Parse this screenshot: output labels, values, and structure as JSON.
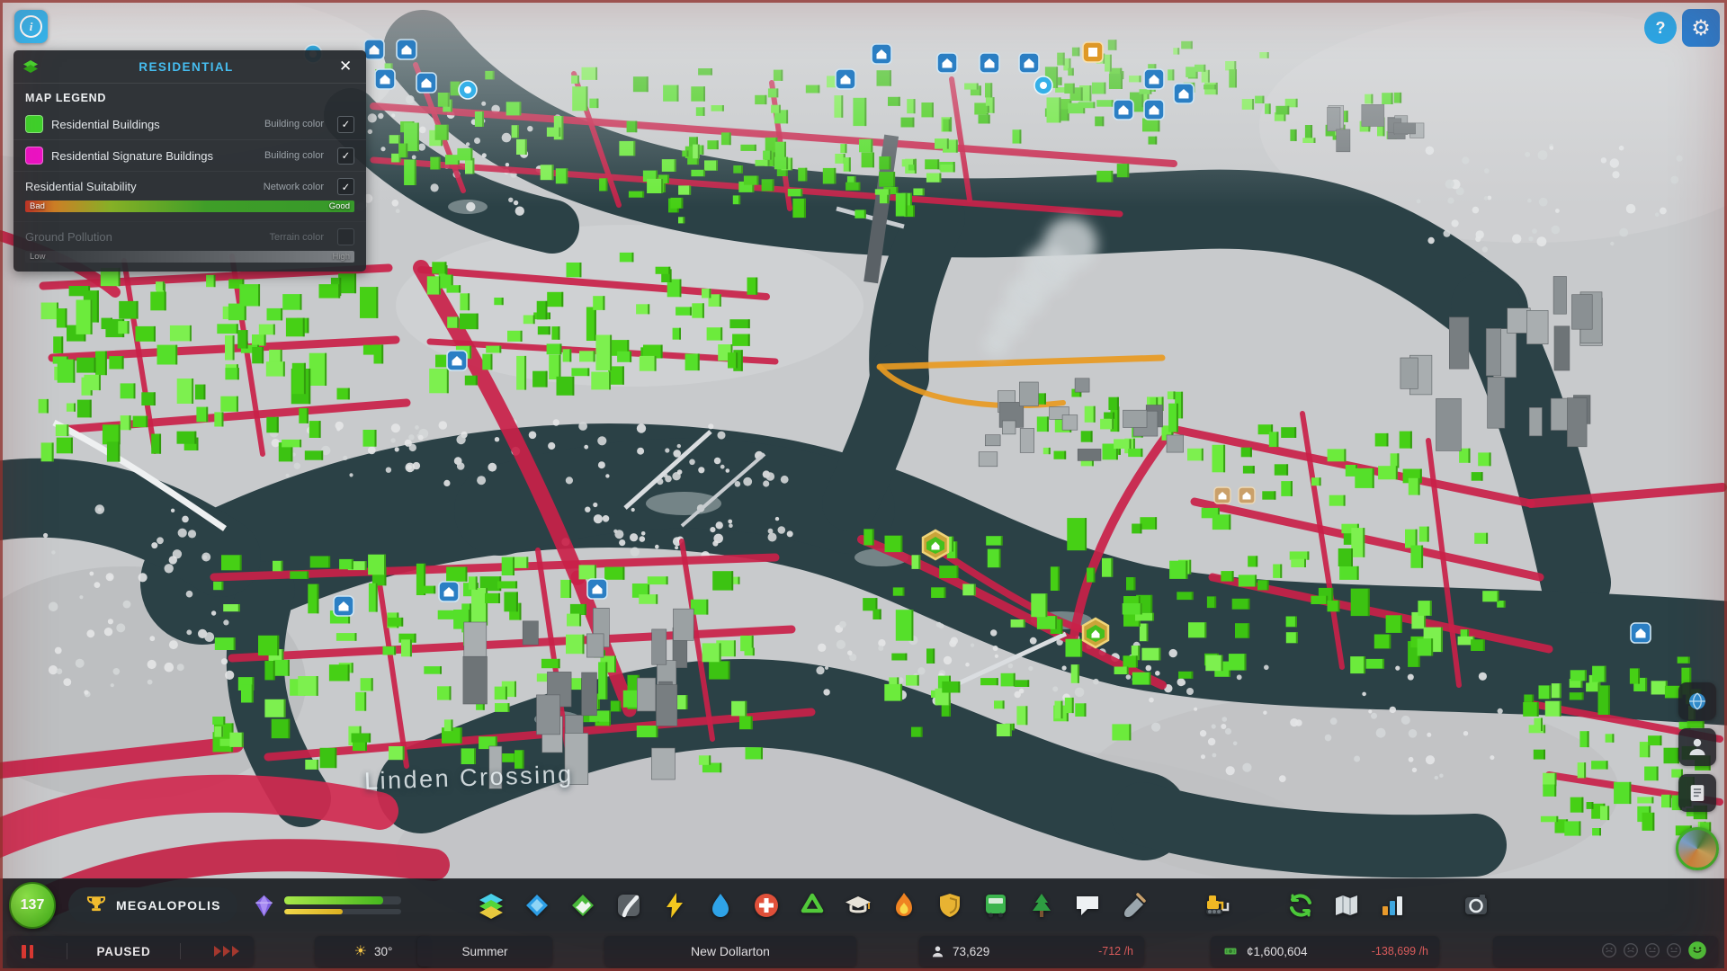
{
  "icons": {
    "check": "✓",
    "close": "✕",
    "help": "?",
    "info": "i",
    "gear": "⚙",
    "sun": "☀"
  },
  "colors": {
    "accent_cyan": "#46bdf0",
    "residential_green": "#3ed32b",
    "signature_magenta": "#ee13c6",
    "road_suitability_red": "#c92149",
    "negative_red": "#e06060",
    "money_green": "#4cb848"
  },
  "legend": {
    "title": "RESIDENTIAL",
    "section": "MAP LEGEND",
    "rows": [
      {
        "label": "Residential Buildings",
        "type": "Building color",
        "checked": true,
        "swatch": "#3ed32b"
      },
      {
        "label": "Residential Signature Buildings",
        "type": "Building color",
        "checked": true,
        "swatch": "#ee13c6"
      },
      {
        "label": "Residential Suitability",
        "type": "Network color",
        "checked": true,
        "scale_min": "Bad",
        "scale_max": "Good"
      },
      {
        "label": "Ground Pollution",
        "type": "Terrain color",
        "checked": false,
        "scale_min": "Low",
        "scale_max": "High",
        "disabled": true
      }
    ]
  },
  "map": {
    "place_label": "Linden Crossing"
  },
  "toolbar": {
    "xp": "137",
    "milestone": "MEGALOPOLIS",
    "progress": {
      "primary_pct": 85,
      "secondary_pct": 50
    },
    "tools": [
      {
        "name": "zoning",
        "icon": "zones"
      },
      {
        "name": "signature-areas",
        "icon": "diamond"
      },
      {
        "name": "terrain",
        "icon": "terrain"
      },
      {
        "name": "roads",
        "icon": "roads"
      },
      {
        "name": "electricity",
        "icon": "bolt"
      },
      {
        "name": "water-sewage",
        "icon": "drop"
      },
      {
        "name": "healthcare",
        "icon": "health"
      },
      {
        "name": "garbage",
        "icon": "recycle"
      },
      {
        "name": "education",
        "icon": "education"
      },
      {
        "name": "fire-rescue",
        "icon": "fire"
      },
      {
        "name": "police",
        "icon": "shield"
      },
      {
        "name": "transportation",
        "icon": "bus"
      },
      {
        "name": "parks-recreation",
        "icon": "tree"
      },
      {
        "name": "communications",
        "icon": "chat"
      },
      {
        "name": "landscaping",
        "icon": "shovel"
      },
      {
        "name": "bulldozer",
        "icon": "bulldozer",
        "gap": true
      },
      {
        "name": "economy",
        "icon": "economy",
        "gap": true
      },
      {
        "name": "info-views",
        "icon": "map"
      },
      {
        "name": "statistics",
        "icon": "chart"
      },
      {
        "name": "photo-mode",
        "icon": "camera",
        "gap": true
      }
    ]
  },
  "side_buttons": [
    {
      "name": "map-options",
      "icon": "orb"
    },
    {
      "name": "citizens",
      "icon": "person"
    },
    {
      "name": "journal",
      "icon": "journal"
    },
    {
      "name": "progression",
      "icon": "avatar"
    }
  ],
  "status_bar": {
    "sim_state": "PAUSED",
    "temperature": "30°",
    "season": "Summer",
    "city_name": "New Dollarton",
    "population": "73,629",
    "population_rate": "-712 /h",
    "money": "¢1,600,604",
    "money_rate": "-138,699 /h",
    "happiness_moods": [
      "sad",
      "sad",
      "neutral",
      "neutral",
      "happy"
    ]
  }
}
